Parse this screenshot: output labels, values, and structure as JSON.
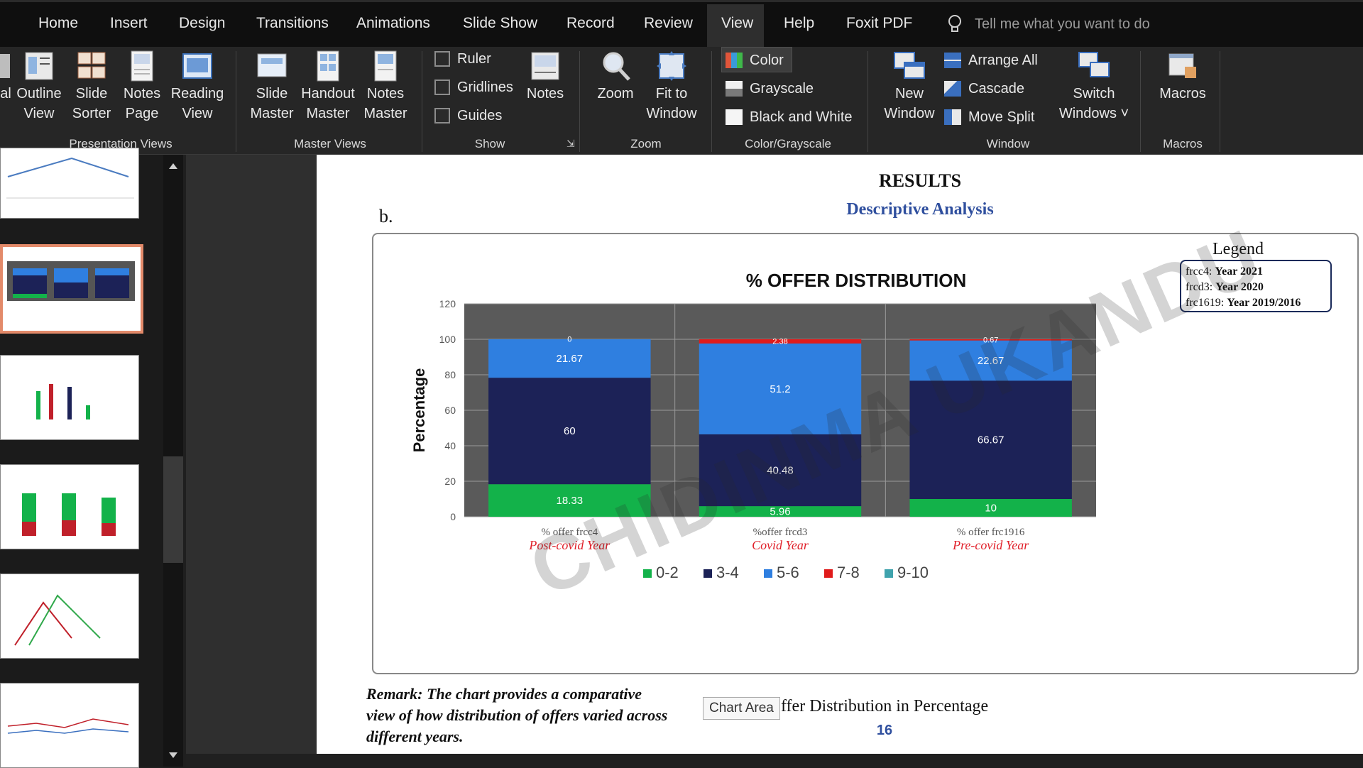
{
  "ribbon_tabs": [
    {
      "label": "Home"
    },
    {
      "label": "Insert"
    },
    {
      "label": "Design"
    },
    {
      "label": "Transitions"
    },
    {
      "label": "Animations"
    },
    {
      "label": "Slide Show"
    },
    {
      "label": "Record"
    },
    {
      "label": "Review"
    },
    {
      "label": "View",
      "active": true
    },
    {
      "label": "Help"
    },
    {
      "label": "Foxit PDF"
    }
  ],
  "tell_me": "Tell me what you want to do",
  "groups": {
    "presentation_views": {
      "label": "Presentation Views",
      "buttons": [
        {
          "line1": "al",
          "line2": ""
        },
        {
          "line1": "Outline",
          "line2": "View"
        },
        {
          "line1": "Slide",
          "line2": "Sorter"
        },
        {
          "line1": "Notes",
          "line2": "Page"
        },
        {
          "line1": "Reading",
          "line2": "View"
        }
      ]
    },
    "master_views": {
      "label": "Master Views",
      "buttons": [
        {
          "line1": "Slide",
          "line2": "Master"
        },
        {
          "line1": "Handout",
          "line2": "Master"
        },
        {
          "line1": "Notes",
          "line2": "Master"
        }
      ]
    },
    "show": {
      "label": "Show",
      "checks": [
        {
          "label": "Ruler",
          "checked": false
        },
        {
          "label": "Gridlines",
          "checked": false
        },
        {
          "label": "Guides",
          "checked": false
        }
      ],
      "notes_label": "Notes"
    },
    "zoom": {
      "label": "Zoom",
      "buttons": [
        {
          "line1": "Zoom",
          "line2": ""
        },
        {
          "line1": "Fit to",
          "line2": "Window"
        }
      ]
    },
    "color": {
      "label": "Color/Grayscale",
      "items": [
        {
          "label": "Color",
          "selected": true
        },
        {
          "label": "Grayscale"
        },
        {
          "label": "Black and White"
        }
      ]
    },
    "window": {
      "label": "Window",
      "new_window": {
        "line1": "New",
        "line2": "Window"
      },
      "items": [
        {
          "label": "Arrange All"
        },
        {
          "label": "Cascade"
        },
        {
          "label": "Move Split"
        }
      ],
      "switch": {
        "line1": "Switch",
        "line2": "Windows ˅"
      }
    },
    "macros": {
      "label": "Macros",
      "button": "Macros"
    }
  },
  "slide": {
    "heading": "RESULTS",
    "subheading": "Descriptive Analysis",
    "letter": "b.",
    "legend_title": "Legend",
    "legend_lines": [
      {
        "code": "frcc4: ",
        "year": "Year 2021"
      },
      {
        "code": "frcd3: ",
        "year": "Year 2020"
      },
      {
        "code": "frc1619: ",
        "year": "Year 2019/2016"
      }
    ],
    "remark": "Remark: The chart provides a comparative view of how distribution of offers varied across different years.",
    "chart_area_tip": "Chart Area",
    "caption": "ffer Distribution in Percentage",
    "page_number": "16",
    "watermark": "CHIDINMA UKANDU"
  },
  "chart_data": {
    "type": "bar",
    "stacked": true,
    "title": "% OFFER DISTRIBUTION",
    "xlabel": "",
    "ylabel": "Percentage",
    "ylim": [
      0,
      120
    ],
    "yticks": [
      0,
      20,
      40,
      60,
      80,
      100,
      120
    ],
    "grid": true,
    "legend_position": "bottom",
    "categories": [
      "% offer frcc4",
      "%offer frcd3",
      "% offer frc1916"
    ],
    "category_sublabels": [
      "Post-covid Year",
      "Covid Year",
      "Pre-covid Year"
    ],
    "series": [
      {
        "name": "0-2",
        "color": "#13b24a",
        "values": [
          18.33,
          5.96,
          10
        ]
      },
      {
        "name": "3-4",
        "color": "#1c2257",
        "values": [
          60,
          40.48,
          66.67
        ]
      },
      {
        "name": "5-6",
        "color": "#2f7fe0",
        "values": [
          21.67,
          51.2,
          22.67
        ]
      },
      {
        "name": "7-8",
        "color": "#e01b1b",
        "values": [
          0,
          2.38,
          0.67
        ]
      },
      {
        "name": "9-10",
        "color": "#3fa3ad",
        "values": [
          0,
          0,
          0
        ]
      }
    ],
    "data_labels": [
      [
        "18.33",
        "5.96",
        "10"
      ],
      [
        "60",
        "40.48",
        "66.67"
      ],
      [
        "21.67",
        "51.2",
        "22.67"
      ],
      [
        "0",
        "2.38",
        "0.67"
      ]
    ],
    "plot_background": "#5a5a5a"
  }
}
